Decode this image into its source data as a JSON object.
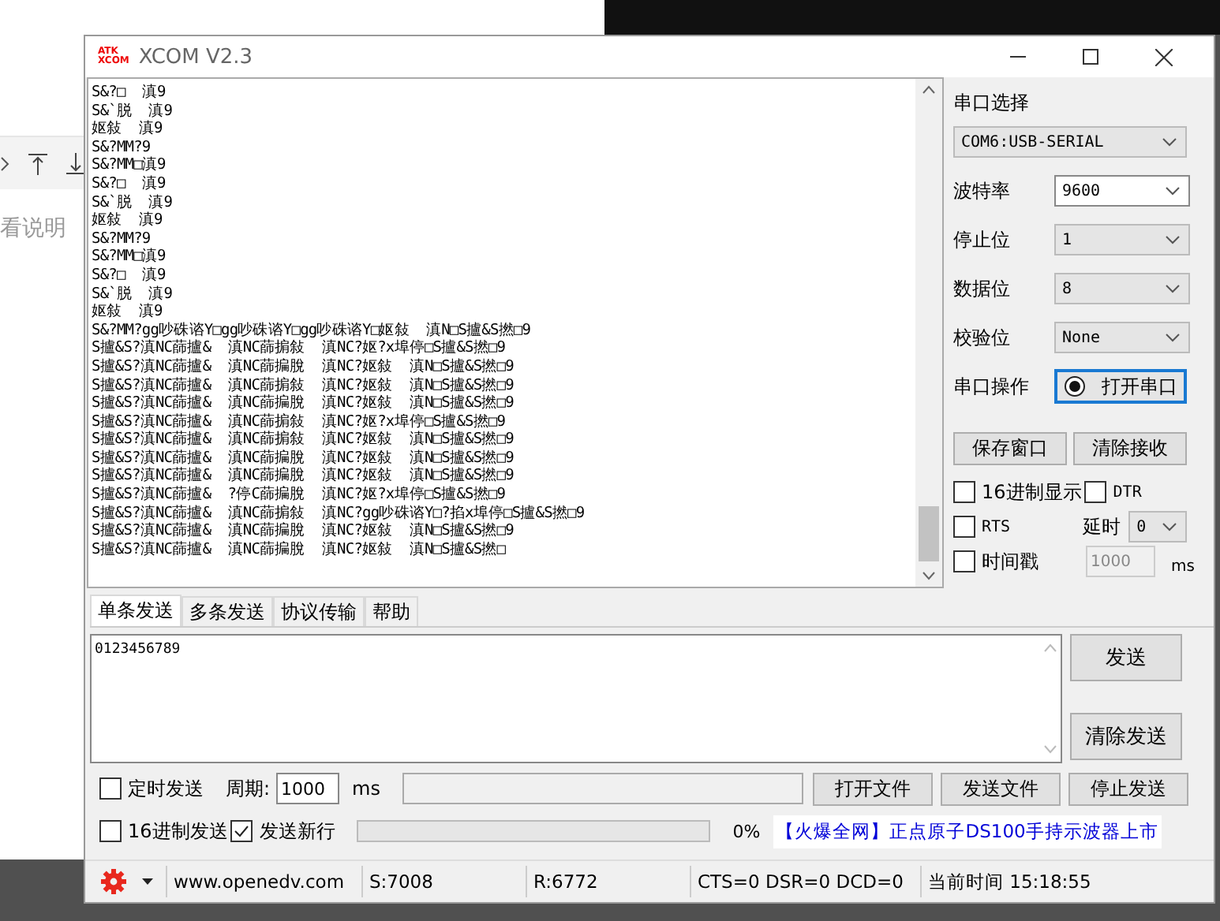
{
  "background": {
    "text": "看说明"
  },
  "window": {
    "title": "XCOM V2.3",
    "logo": [
      "ATK",
      "XCOM"
    ]
  },
  "receive": {
    "lines": [
      "S&?□  滇9",
      "S&`脱  滇9",
      "妪敍  滇9",
      "S&?MM?9",
      "S&?MM□滇9",
      "S&?□  滇9",
      "S&`脱  滇9",
      "妪敍  滇9",
      "S&?MM?9",
      "S&?MM□滇9",
      "S&?□  滇9",
      "S&`脱  滇9",
      "妪敍  滇9",
      "S&?MM?gg吵硃谘Y□gg吵硃谘Y□gg吵硃谘Y□妪敍  滇N□S攎&S撚□9",
      "S攎&S?滇NC蒒攎&  滇NC蒒掮敍  滇NC?妪?x埠停□S攎&S撚□9",
      "S攎&S?滇NC蒒攎&  滇NC蒒揙脫  滇NC?妪敍  滇N□S攎&S撚□9",
      "S攎&S?滇NC蒒攎&  滇NC蒒掮敍  滇NC?妪敍  滇N□S攎&S撚□9",
      "S攎&S?滇NC蒒攎&  滇NC蒒揙脫  滇NC?妪敍  滇N□S攎&S撚□9",
      "S攎&S?滇NC蒒攎&  滇NC蒒掮敍  滇NC?妪?x埠停□S攎&S撚□9",
      "S攎&S?滇NC蒒攎&  滇NC蒒掮敍  滇NC?妪敍  滇N□S攎&S撚□9",
      "S攎&S?滇NC蒒攎&  滇NC蒒揙脫  滇NC?妪敍  滇N□S攎&S撚□9",
      "S攎&S?滇NC蒒攎&  滇NC蒒揙脫  滇NC?妪敍  滇N□S攎&S撚□9",
      "S攎&S?滇NC蒒攎&  ?停C蒒揙脫  滇NC?妪?x埠停□S攎&S撚□9",
      "S攎&S?滇NC蒒攎&  滇NC蒒掮敍  滇NC?gg吵硃谘Y□?掐x埠停□S攎&S撚□9",
      "S攎&S?滇NC蒒攎&  滇NC蒒揙脫  滇NC?妪敍  滇N□S攎&S撚□9",
      "S攎&S?滇NC蒒攎&  滇NC蒒揙脫  滇NC?妪敍  滇N□S攎&S撚□"
    ]
  },
  "panel": {
    "port_label": "串口选择",
    "port": "COM6:USB-SERIAL",
    "settings": [
      {
        "label": "波特率",
        "value": "9600",
        "kind": "combo"
      },
      {
        "label": "停止位",
        "value": "1",
        "kind": "select"
      },
      {
        "label": "数据位",
        "value": "8",
        "kind": "select"
      },
      {
        "label": "校验位",
        "value": "None",
        "kind": "select"
      }
    ],
    "operation_label": "串口操作",
    "open_button": "打开串口",
    "buttons": [
      "保存窗口",
      "清除接收"
    ],
    "hex_display": {
      "label": "16进制显示",
      "checked": false
    },
    "dtr": {
      "label": "DTR",
      "checked": false
    },
    "rts": {
      "label": "RTS",
      "checked": false
    },
    "delay": {
      "label": "延时",
      "value": "0"
    },
    "timestamp": {
      "label": "时间戳",
      "checked": false
    },
    "interval": {
      "placeholder": "1000",
      "unit": "ms"
    }
  },
  "send": {
    "tabs": [
      {
        "label": "单条发送",
        "selected": true
      },
      {
        "label": "多条发送",
        "selected": false
      },
      {
        "label": "协议传输",
        "selected": false
      },
      {
        "label": "帮助",
        "selected": false
      }
    ],
    "text": "0123456789",
    "send_button": "发送",
    "clear_button": "清除发送",
    "timed": {
      "label": "定时发送",
      "checked": false
    },
    "period": {
      "label": "周期:",
      "value": "1000",
      "unit": "ms"
    },
    "file_buttons": [
      "打开文件",
      "发送文件",
      "停止发送"
    ],
    "hex_send": {
      "label": "16进制发送",
      "checked": false
    },
    "newline": {
      "label": "发送新行",
      "checked": true
    },
    "progress": {
      "level": 0,
      "reading": "0%"
    },
    "ad": "【火爆全网】正点原子DS100手持示波器上市"
  },
  "status_bar": {
    "website": "www.openedv.com",
    "sent": "S:7008",
    "received": "R:6772",
    "lines": "CTS=0 DSR=0 DCD=0",
    "time": "当前时间 15:18:55"
  }
}
